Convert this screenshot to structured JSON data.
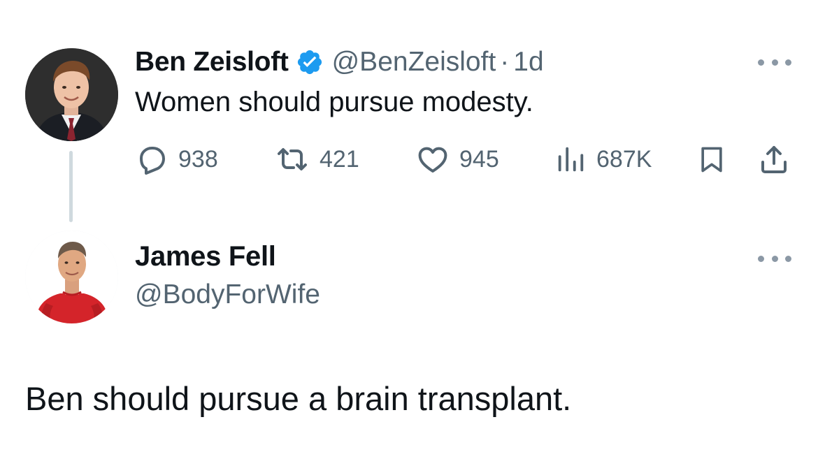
{
  "original_tweet": {
    "author_name": "Ben Zeisloft",
    "verified": true,
    "handle": "@BenZeisloft",
    "separator": "·",
    "time": "1d",
    "text": "Women should pursue modesty.",
    "stats": {
      "replies": "938",
      "retweets": "421",
      "likes": "945",
      "views": "687K"
    },
    "icons": {
      "reply": "reply-icon",
      "retweet": "retweet-icon",
      "like": "heart-icon",
      "views": "views-icon",
      "bookmark": "bookmark-icon",
      "share": "share-icon",
      "more": "more-icon",
      "verified": "verified-badge-icon"
    }
  },
  "reply_tweet": {
    "author_name": "James Fell",
    "handle": "@BodyForWife",
    "text": "Ben should pursue a brain transplant."
  },
  "colors": {
    "text_primary": "#0f1419",
    "text_secondary": "#536471",
    "verified_blue": "#1d9bf0",
    "thread_line": "#cfd9de"
  }
}
